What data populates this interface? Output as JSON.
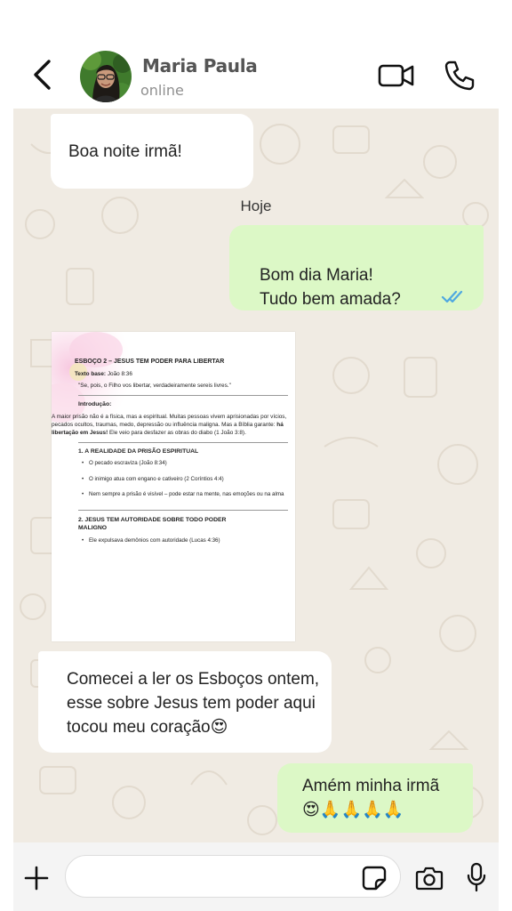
{
  "header": {
    "contact_name": "Maria Paula",
    "status": "online"
  },
  "messages": [
    {
      "direction": "incoming",
      "text": "Boa noite irmã!"
    },
    {
      "direction": "outgoing",
      "text": "Bom dia Maria!\nTudo bem amada?",
      "read_status": "read"
    },
    {
      "direction": "incoming",
      "type": "image"
    },
    {
      "direction": "incoming",
      "text": "Comecei a ler os Esboços ontem, esse sobre Jesus tem poder aqui tocou meu coração",
      "emoji": "😍"
    },
    {
      "direction": "outgoing",
      "text": "Amém minha irmã",
      "emoji": "😍🙏🙏🙏🙏"
    }
  ],
  "date_divider": "Hoje",
  "document": {
    "title": "ESBOÇO 2 – JESUS TEM PODER PARA LIBERTAR",
    "base_text_label": "Texto base:",
    "base_text_ref": "João 8:36",
    "quote": "\"Se, pois, o Filho vos libertar, verdadeiramente sereis livres.\"",
    "intro_heading": "Introdução:",
    "intro_text": "A maior prisão não é a física, mas a espiritual. Muitas pessoas vivem aprisionadas por vícios, pecados ocultos, traumas, medo, depressão ou influência maligna. Mas a Bíblia garante:",
    "intro_bold": "há libertação em Jesus!",
    "intro_tail": "Ele veio para desfazer as obras do diabo (1 João 3:8).",
    "section1": "1. A REALIDADE DA PRISÃO ESPIRITUAL",
    "section1_bullets": [
      "O pecado escraviza (João 8:34)",
      "O inimigo atua com engano e cativeiro (2 Coríntios 4:4)",
      "Nem sempre a prisão é visível – pode estar na mente, nas emoções ou na alma"
    ],
    "section2": "2. JESUS TEM AUTORIDADE SOBRE TODO PODER MALIGNO",
    "section2_bullets": [
      "Ele expulsava demônios com autoridade (Lucas 4:36)"
    ]
  },
  "composer": {
    "placeholder": ""
  },
  "colors": {
    "incoming_bubble": "#ffffff",
    "outgoing_bubble": "#dcf8c6",
    "chat_background": "#f0ebe3",
    "read_ticks": "#4fa8e0"
  },
  "icons": [
    "back-arrow-icon",
    "video-call-icon",
    "phone-icon",
    "plus-icon",
    "sticker-icon",
    "camera-icon",
    "microphone-icon",
    "double-check-icon"
  ]
}
